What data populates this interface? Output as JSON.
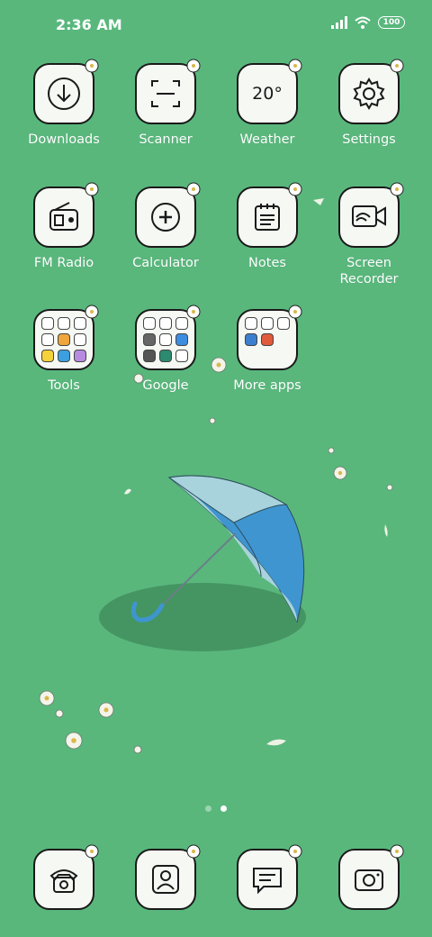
{
  "status_bar": {
    "time": "2:36 AM",
    "battery": "100"
  },
  "apps": [
    {
      "label": "Downloads",
      "icon": "download-icon"
    },
    {
      "label": "Scanner",
      "icon": "scanner-icon"
    },
    {
      "label": "Weather",
      "icon": "weather-icon",
      "text": "20°"
    },
    {
      "label": "Settings",
      "icon": "gear-icon"
    },
    {
      "label": "FM Radio",
      "icon": "radio-icon"
    },
    {
      "label": "Calculator",
      "icon": "calculator-icon"
    },
    {
      "label": "Notes",
      "icon": "notes-icon"
    },
    {
      "label": "Screen Recorder",
      "icon": "screen-recorder-icon"
    },
    {
      "label": "Tools",
      "icon": "tools-folder-icon"
    },
    {
      "label": "Google",
      "icon": "google-folder-icon"
    },
    {
      "label": "More apps",
      "icon": "more-apps-folder-icon"
    }
  ],
  "dock": [
    {
      "icon": "phone-icon"
    },
    {
      "icon": "contacts-icon"
    },
    {
      "icon": "messages-icon"
    },
    {
      "icon": "camera-icon"
    }
  ],
  "page_indicator": {
    "count": 2,
    "active": 2
  },
  "colors": {
    "background": "#59b77c",
    "tile": "#f6f8f3",
    "umbrella_light": "#a8d3dc",
    "umbrella_dark": "#3f95d0"
  }
}
